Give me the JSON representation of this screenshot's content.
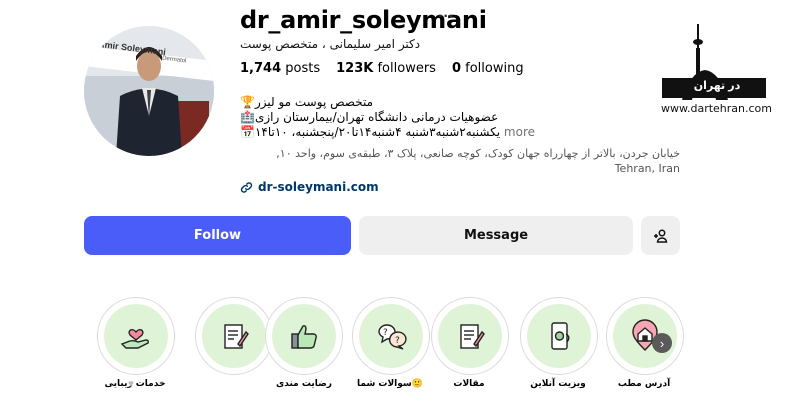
{
  "profile": {
    "username": "dr_amir_soleymani",
    "more_dots": "···",
    "full_name": "دکتر امیر سلیمانی ، متخصص پوست",
    "posts_count": "1,744",
    "posts_label": "posts",
    "followers_count": "123K",
    "followers_label": "followers",
    "following_count": "0",
    "following_label": "following",
    "avatar_banner": "Amir Soleymani",
    "avatar_banner_sub": "Dermatol"
  },
  "bio": {
    "line1": "🏆متخصص پوست مو لیزر",
    "line2": "🏥عضوهیات درمانی دانشگاه تهران/بیمارستان رازی",
    "line3": "📅یکشنبه۲شنبه۳شنبه ۴شنبه۱۴تا۲۰/پنجشنبه، ۱۰تا۱۴",
    "more_label": "more",
    "address": "خیابان جردن، بالاتر از چهارراه جهان کودک، کوچه صانعی، پلاک ۳، طبقه‌ی سوم، واحد ۱۰, Tehran, Iran",
    "link": "dr-soleymani.com"
  },
  "actions": {
    "follow": "Follow",
    "message": "Message"
  },
  "watermark": {
    "logo_text": "در تهران",
    "url": "www.dartehran.com"
  },
  "highlights": [
    {
      "label": "خدمات زیبایی",
      "icon": "hand-heart-icon"
    },
    {
      "label": "رضایت مندی",
      "icon": "thumbs-up-icon"
    },
    {
      "label": "🙂سوالات شما",
      "icon": "question-bubbles-icon"
    },
    {
      "label": "مقالات",
      "icon": "article-icon"
    },
    {
      "label": "ویزیت آنلاین",
      "icon": "phone-medical-icon"
    },
    {
      "label": "آدرس مطب",
      "icon": "location-home-icon"
    }
  ],
  "colors": {
    "follow_bg": "#4a5df9",
    "highlight_bg": "#dff3d6",
    "link": "#00376b"
  }
}
